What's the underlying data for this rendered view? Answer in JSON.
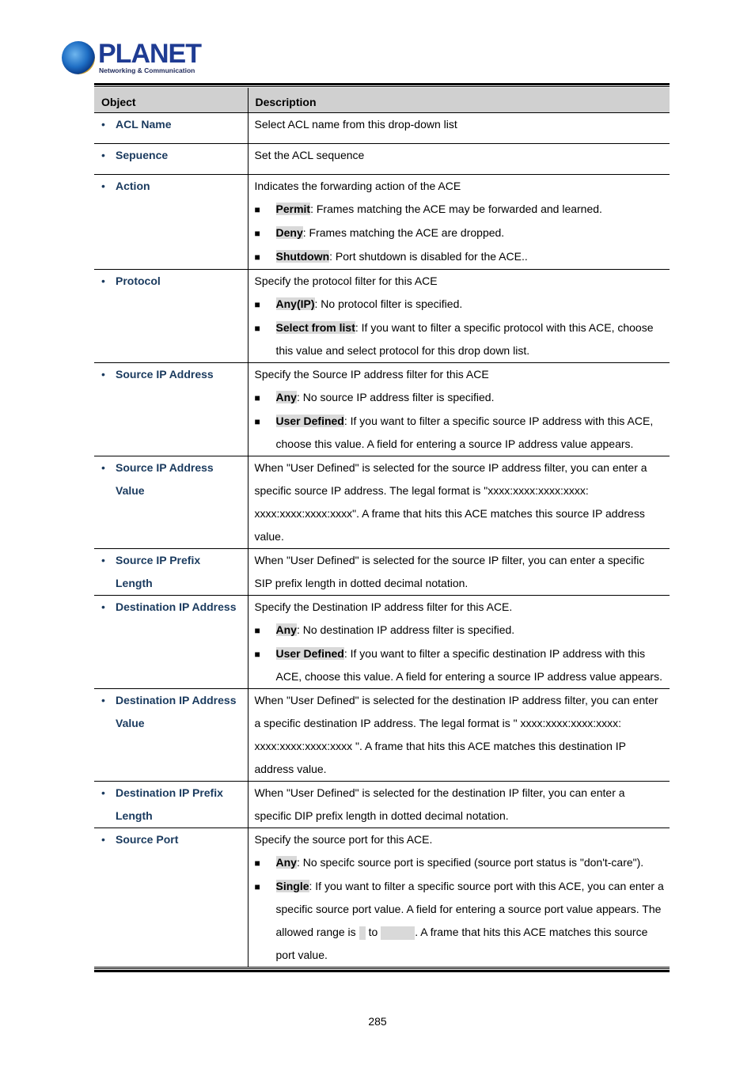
{
  "header": {
    "brand": "PLANET",
    "tagline": "Networking & Communication"
  },
  "table": {
    "columns": [
      "Object",
      "Description"
    ],
    "rows": [
      {
        "object": "ACL Name",
        "object_line2": "",
        "intro": [
          "Select ACL name from this drop-down list"
        ],
        "bullets": []
      },
      {
        "object": "Sepuence",
        "object_line2": "",
        "intro": [
          "Set the ACL sequence"
        ],
        "bullets": []
      },
      {
        "object": "Action",
        "object_line2": "",
        "intro": [
          "Indicates the forwarding action of the ACE"
        ],
        "bullets": [
          {
            "term": "Permit",
            "text": ": Frames matching the ACE may be forwarded and learned."
          },
          {
            "term": "Deny",
            "text": ": Frames matching the ACE are dropped."
          },
          {
            "term": "Shutdown",
            "text": ": Port shutdown is disabled for the ACE.."
          }
        ]
      },
      {
        "object": "Protocol",
        "object_line2": "",
        "intro": [
          "Specify the protocol filter for this ACE"
        ],
        "bullets": [
          {
            "term": "Any(IP)",
            "text": ": No protocol filter is specified."
          },
          {
            "term": "Select from list",
            "text": ": If you want to filter a specific protocol with this ACE, choose this value and select protocol for this drop down list."
          }
        ]
      },
      {
        "object": "Source IP Address",
        "object_line2": "",
        "intro": [
          "Specify the Source IP address filter for this ACE"
        ],
        "bullets": [
          {
            "term": "Any",
            "text": ": No source IP address filter is specified."
          },
          {
            "term": "User Defined",
            "text": ": If you want to filter a specific source IP address with this ACE, choose this value. A field for entering a source IP address value appears."
          }
        ]
      },
      {
        "object": "Source IP Address",
        "object_line2": "Value",
        "intro": [
          "When \"User Defined\" is selected for the source IP address filter, you can enter a specific source IP address. The legal format is \"xxxx:xxxx:xxxx:xxxx: xxxx:xxxx:xxxx:xxxx\". A frame that hits this ACE matches this source IP address value."
        ],
        "bullets": []
      },
      {
        "object": "Source IP Prefix",
        "object_line2": "Length",
        "intro": [
          "When \"User Defined\" is selected for the source IP filter, you can enter a specific SIP prefix length in dotted decimal notation."
        ],
        "bullets": []
      },
      {
        "object": "Destination IP Address",
        "object_line2": "",
        "intro": [
          "Specify the Destination IP address filter for this ACE."
        ],
        "bullets": [
          {
            "term": "Any",
            "text": ": No destination IP address filter is specified."
          },
          {
            "term": "User Defined",
            "text": ": If you want to filter a specific destination IP address with this ACE, choose this value. A field for entering a source IP address value appears."
          }
        ]
      },
      {
        "object": "Destination IP Address",
        "object_line2": "Value",
        "intro": [
          "When \"User Defined\" is selected for the destination IP address filter, you can enter a specific destination IP address. The legal format is \" xxxx:xxxx:xxxx:xxxx: xxxx:xxxx:xxxx:xxxx \". A frame that hits this ACE matches this destination IP address value."
        ],
        "bullets": []
      },
      {
        "object": "Destination IP Prefix",
        "object_line2": "Length",
        "intro": [
          "When \"User Defined\" is selected for the destination IP filter, you can enter a specific DIP prefix length in dotted decimal notation."
        ],
        "bullets": []
      },
      {
        "object": "Source Port",
        "object_line2": "",
        "intro": [
          "Specify the source port for this ACE."
        ],
        "bullets": [
          {
            "term": "Any",
            "text": ": No specifc source port is specified (source port status is \"don't-care\")."
          },
          {
            "term": "Single",
            "text": ": If you want to filter a specific source port with this ACE, you can enter a specific source port value. A field for entering a source port value appears. The allowed range is ",
            "range_to": "to",
            "text_after": ". A frame that hits this ACE matches this source port value."
          }
        ]
      }
    ]
  },
  "footer": {
    "page_number": "285"
  }
}
